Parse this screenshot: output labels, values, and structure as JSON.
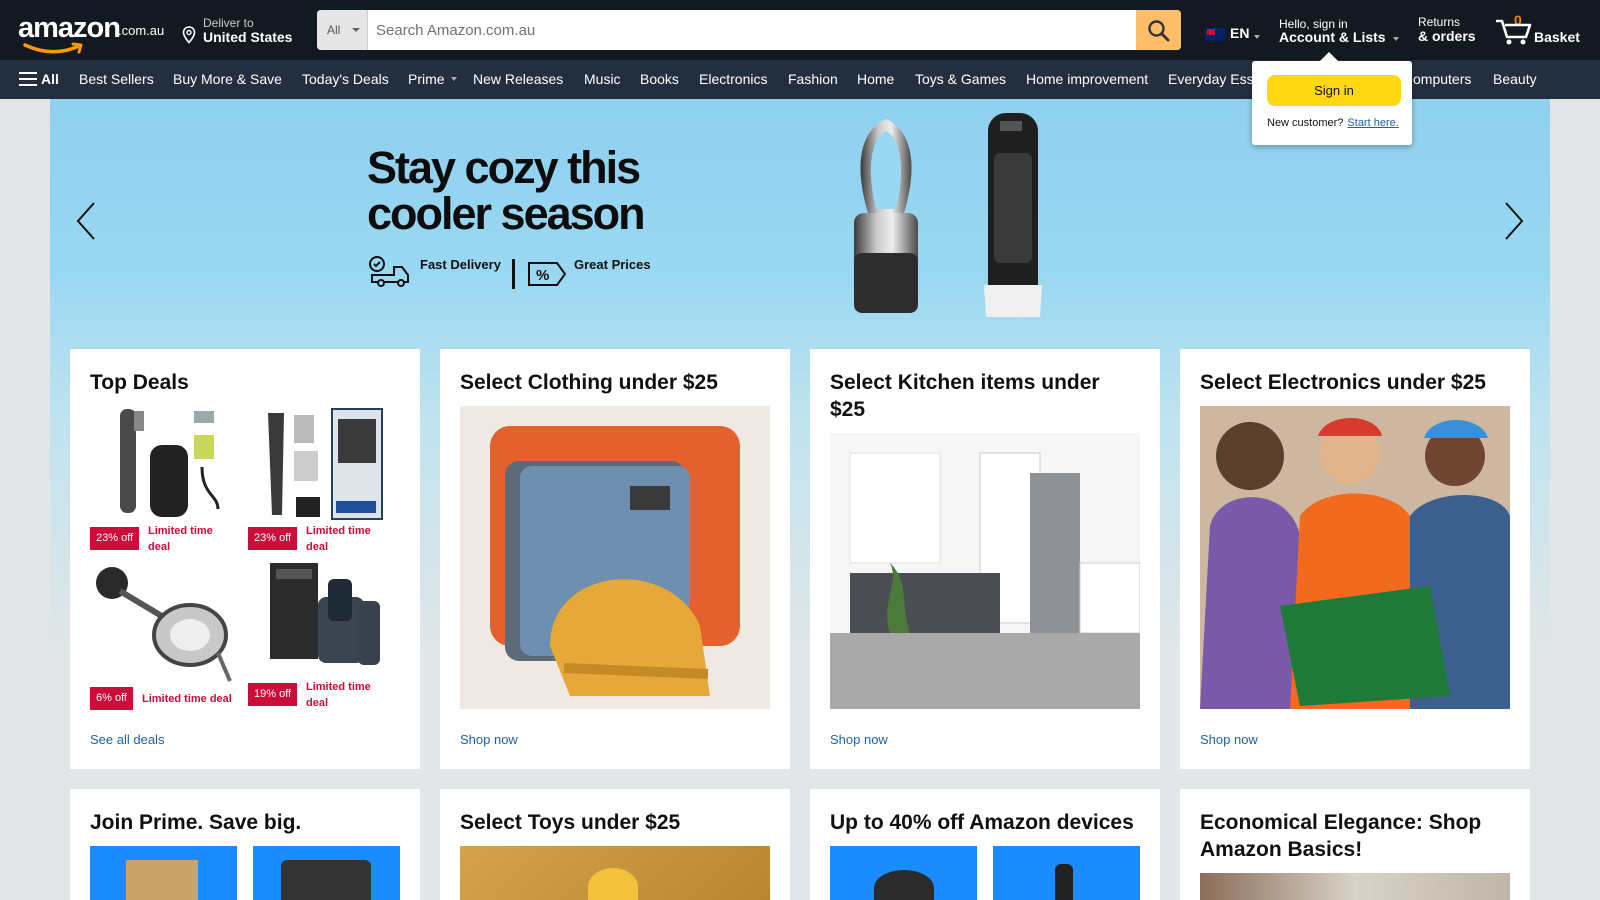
{
  "header": {
    "logo_text": "amazon",
    "logo_tld": ".com.au",
    "deliver_line1": "Deliver to",
    "deliver_line2": "United States",
    "search_category": "All",
    "search_placeholder": "Search Amazon.com.au",
    "language": "EN",
    "account_line1": "Hello, sign in",
    "account_line2": "Account & Lists",
    "returns_line1": "Returns",
    "returns_line2": "& orders",
    "basket_count": "0",
    "basket_label": "Basket"
  },
  "nav": {
    "all_label": "All",
    "items": [
      "Best Sellers",
      "Buy More & Save",
      "Today's Deals",
      "Prime",
      "New Releases",
      "Music",
      "Books",
      "Electronics",
      "Fashion",
      "Home",
      "Toys & Games",
      "Home improvement",
      "Everyday Ess",
      "omputers",
      "Beauty"
    ]
  },
  "signin_flyout": {
    "button": "Sign in",
    "new_customer": "New customer?",
    "start_here": "Start here."
  },
  "hero": {
    "headline_line1": "Stay cozy this",
    "headline_line2": "cooler season",
    "feature1": "Fast Delivery",
    "feature2": "Great Prices"
  },
  "cards": [
    {
      "title": "Top Deals",
      "link": "See all deals",
      "deals": [
        {
          "badge": "23% off",
          "label": "Limited time deal"
        },
        {
          "badge": "23% off",
          "label": "Limited time deal"
        },
        {
          "badge": "6% off",
          "label": "Limited time deal"
        },
        {
          "badge": "19% off",
          "label": "Limited time deal"
        }
      ]
    },
    {
      "title": "Select Clothing under $25",
      "link": "Shop now"
    },
    {
      "title": "Select Kitchen items under $25",
      "link": "Shop now"
    },
    {
      "title": "Select Electronics under $25",
      "link": "Shop now"
    }
  ],
  "cards_row2": [
    {
      "title": "Join Prime. Save big."
    },
    {
      "title": "Select Toys under $25"
    },
    {
      "title": "Up to 40% off Amazon devices"
    },
    {
      "title": "Economical Elegance: Shop Amazon Basics!"
    }
  ],
  "colors": {
    "header_bg": "#131921",
    "nav_bg": "#232f3e",
    "search_button": "#febd69",
    "signin_button": "#ffd814",
    "deal_badge": "#cc0c39",
    "link": "#2162a1",
    "basket_count": "#f08804"
  }
}
